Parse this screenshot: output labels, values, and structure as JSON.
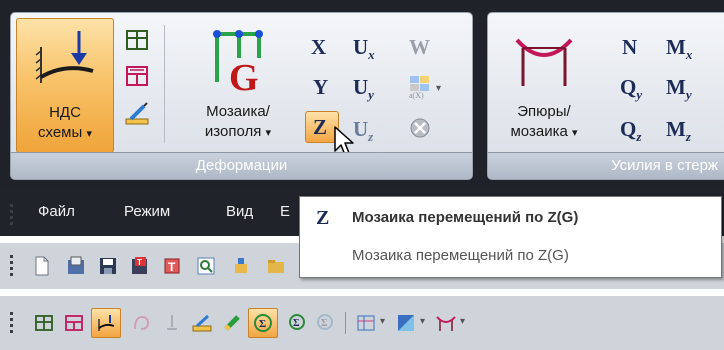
{
  "ribbon": {
    "deformations_panel": {
      "label": "Деформации",
      "nds_button": {
        "line1": "НДС",
        "line2": "схемы",
        "arrow": "▾"
      },
      "mosaic_button": {
        "line1": "Мозаика/",
        "line2": "изополя",
        "arrow": "▾"
      },
      "symbols": {
        "x": "X",
        "ux": "U",
        "ux_sub": "x",
        "w": "W",
        "y": "Y",
        "uy": "U",
        "uy_sub": "y",
        "ax": "a(X)",
        "z": "Z",
        "uz": "U",
        "uz_sub": "z"
      }
    },
    "forces_panel": {
      "label": "Усилия в стерж",
      "epure_button": {
        "line1": "Эпюры/",
        "line2": "мозаика",
        "arrow": "▾"
      },
      "symbols": {
        "n": "N",
        "mx": "M",
        "mx_sub": "x",
        "qy": "Q",
        "qy_sub": "y",
        "my": "M",
        "my_sub": "y",
        "qz": "Q",
        "qz_sub": "z",
        "mz": "M",
        "mz_sub": "z"
      }
    }
  },
  "menubar": {
    "items": [
      "Файл",
      "Режим",
      "Вид",
      "E"
    ]
  },
  "tooltip": {
    "icon_letter": "Z",
    "title": "Мозаика перемещений по Z(G)",
    "description": "Мозаика перемещений по Z(G)"
  },
  "colors": {
    "ribbon_bg": "#1f2228",
    "active_button": "#f5b04a",
    "tooltip_border": "#767676"
  }
}
